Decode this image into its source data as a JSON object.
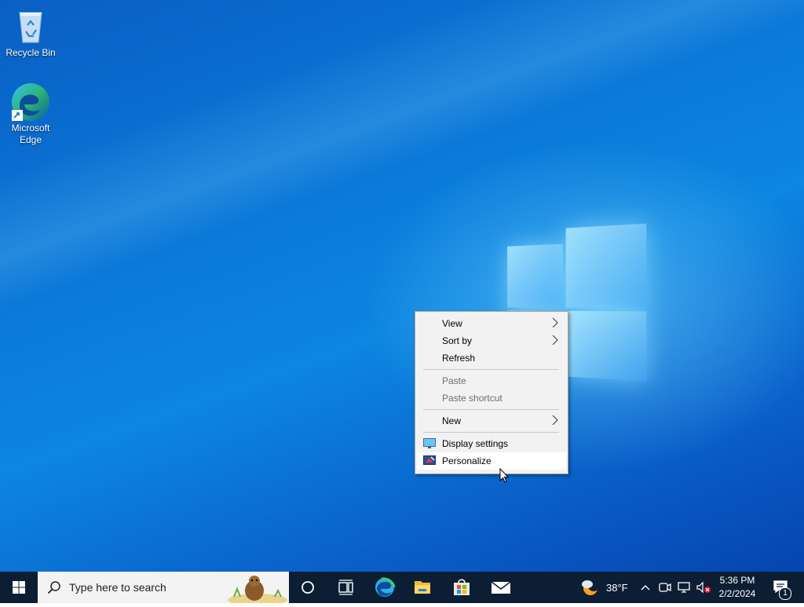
{
  "desktop": {
    "icons": [
      {
        "label": "Recycle Bin",
        "icon": "recycle-bin-icon"
      },
      {
        "label": "Microsoft\nEdge",
        "icon": "edge-icon"
      }
    ]
  },
  "context_menu": {
    "items": [
      {
        "label": "View",
        "submenu": true,
        "enabled": true
      },
      {
        "label": "Sort by",
        "submenu": true,
        "enabled": true
      },
      {
        "label": "Refresh",
        "submenu": false,
        "enabled": true
      },
      {
        "label": "Paste",
        "submenu": false,
        "enabled": false
      },
      {
        "label": "Paste shortcut",
        "submenu": false,
        "enabled": false
      },
      {
        "label": "New",
        "submenu": true,
        "enabled": true
      },
      {
        "label": "Display settings",
        "icon": "display-icon",
        "enabled": true
      },
      {
        "label": "Personalize",
        "icon": "personalize-icon",
        "enabled": true,
        "highlighted": true
      }
    ]
  },
  "taskbar": {
    "search_placeholder": "Type here to search",
    "pinned": [
      "cortana-icon",
      "task-view-icon",
      "edge-icon",
      "file-explorer-icon",
      "store-icon",
      "mail-icon"
    ],
    "weather": {
      "temp": "38°F",
      "icon": "weather-moon-cloud-icon"
    },
    "clock": {
      "time": "5:36 PM",
      "date": "2/2/2024"
    },
    "notifications_count": "1"
  },
  "colors": {
    "taskbar_bg": "#0c1e33",
    "menu_bg": "#f2f2f2",
    "accent": "#0078d7"
  }
}
